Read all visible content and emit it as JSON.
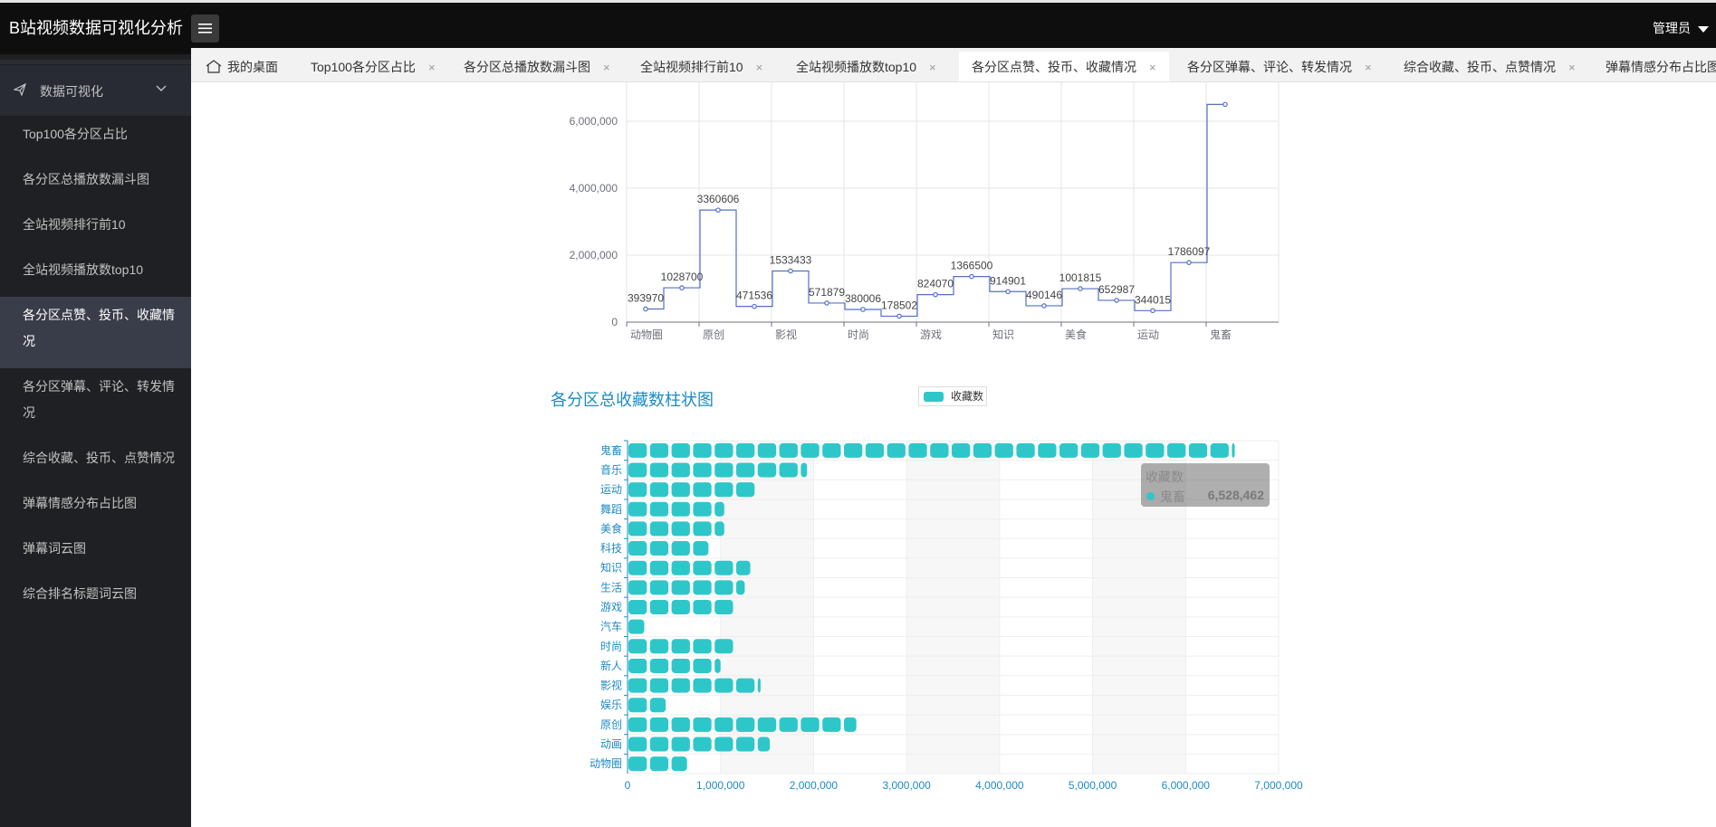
{
  "app": {
    "title": "B站视频数据可视化分析",
    "user": "管理员"
  },
  "sidebar": {
    "group_label": "数据可视化",
    "items": [
      {
        "label": "Top100各分区占比"
      },
      {
        "label": "各分区总播放数漏斗图"
      },
      {
        "label": "全站视频排行前10"
      },
      {
        "label": "全站视频播放数top10"
      },
      {
        "label": "各分区点赞、投币、收藏情况",
        "active": true
      },
      {
        "label": "各分区弹幕、评论、转发情况"
      },
      {
        "label": "综合收藏、投币、点赞情况"
      },
      {
        "label": "弹幕情感分布占比图"
      },
      {
        "label": "弹幕词云图"
      },
      {
        "label": "综合排名标题词云图"
      }
    ]
  },
  "tabs": [
    {
      "label": "我的桌面",
      "closable": false
    },
    {
      "label": "Top100各分区占比",
      "closable": true
    },
    {
      "label": "各分区总播放数漏斗图",
      "closable": true
    },
    {
      "label": "全站视频排行前10",
      "closable": true
    },
    {
      "label": "全站视频播放数top10",
      "closable": true
    },
    {
      "label": "各分区点赞、投币、收藏情况",
      "closable": true,
      "active": true
    },
    {
      "label": "各分区弹幕、评论、转发情况",
      "closable": true
    },
    {
      "label": "综合收藏、投币、点赞情况",
      "closable": true
    },
    {
      "label": "弹幕情感分布占比图",
      "closable": true
    }
  ],
  "close_glyph": "×",
  "chart_data": [
    {
      "type": "line",
      "step": true,
      "color": "#5470c6",
      "categories": [
        "动物圈",
        "原创",
        "影视",
        "时尚",
        "游戏",
        "知识",
        "美食",
        "运动",
        "鬼畜"
      ],
      "y_ticks": [
        "0",
        "2,000,000",
        "4,000,000",
        "6,000,000"
      ],
      "ylim": [
        0,
        7000000
      ],
      "points": [
        393970,
        1028700,
        3360606,
        471536,
        1533433,
        571879,
        380006,
        178502,
        824070,
        1366500,
        914901,
        490146,
        1001815,
        652987,
        344015,
        1786097,
        6528462
      ],
      "point_labels": [
        "393970",
        "1028700",
        "3360606",
        "471536",
        "1533433",
        "571879",
        "380006",
        "178502",
        "824070",
        "1366500",
        "914901",
        "490146",
        "1001815",
        "652987",
        "344015",
        "1786097",
        ""
      ]
    },
    {
      "type": "bar",
      "orientation": "horizontal",
      "title": "各分区总收藏数柱状图",
      "legend": "收藏数",
      "color": "#2ec7c9",
      "categories": [
        "动物圈",
        "动画",
        "原创",
        "娱乐",
        "影视",
        "新人",
        "时尚",
        "汽车",
        "游戏",
        "生活",
        "知识",
        "科技",
        "美食",
        "舞蹈",
        "运动",
        "音乐",
        "鬼畜"
      ],
      "values": [
        640000,
        1530000,
        2460000,
        410000,
        1430000,
        1000000,
        1150000,
        180000,
        1160000,
        1260000,
        1320000,
        870000,
        1040000,
        1040000,
        1390000,
        1930000,
        6528462
      ],
      "x_ticks": [
        "0",
        "1,000,000",
        "2,000,000",
        "3,000,000",
        "4,000,000",
        "5,000,000",
        "6,000,000",
        "7,000,000"
      ],
      "xlim": [
        0,
        7000000
      ]
    }
  ],
  "tooltip": {
    "title": "收藏数",
    "name": "鬼畜",
    "value": "6,528,462"
  }
}
